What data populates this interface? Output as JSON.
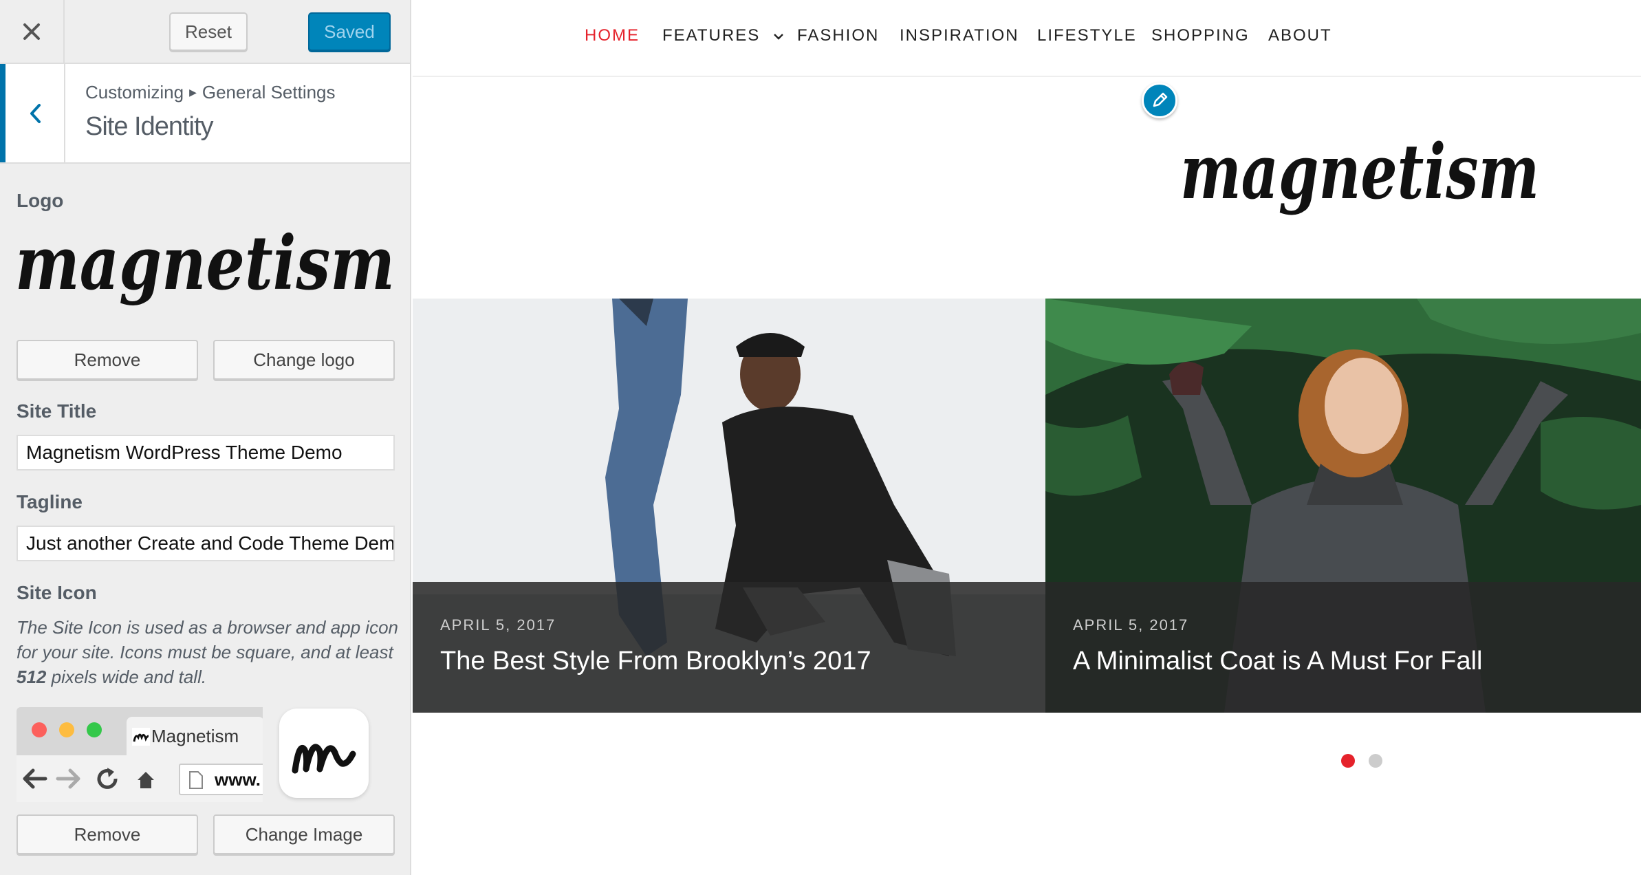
{
  "header": {
    "reset_label": "Reset",
    "saved_label": "Saved",
    "accent": "#0085ba"
  },
  "section": {
    "breadcrumb_parent": "Customizing",
    "breadcrumb_child": "General Settings",
    "title": "Site Identity"
  },
  "logo": {
    "label": "Logo",
    "wordmark": "magnetism",
    "remove_label": "Remove",
    "change_label": "Change logo"
  },
  "site_title": {
    "label": "Site Title",
    "value": "Magnetism WordPress Theme Demo"
  },
  "tagline": {
    "label": "Tagline",
    "value": "Just another Create and Code Theme Demo Sites site"
  },
  "site_icon": {
    "label": "Site Icon",
    "description_prefix": "The Site Icon is used as a browser and app icon for your site. Icons must be square, and at least ",
    "description_bold": "512",
    "description_suffix": " pixels wide and tall.",
    "tab_title": "Magnetism",
    "url": "www.",
    "remove_label": "Remove",
    "change_label": "Change Image"
  },
  "nav": {
    "items": [
      "HOME",
      "FEATURES",
      "FASHION",
      "INSPIRATION",
      "LIFESTYLE",
      "SHOPPING",
      "ABOUT"
    ],
    "active_color": "#e5222b"
  },
  "slides": [
    {
      "date": "APRIL 5, 2017",
      "title": "The Best Style From Brooklyn’s 2017"
    },
    {
      "date": "APRIL 5, 2017",
      "title": "A Minimalist Coat is A Must For Fall"
    }
  ],
  "pagination": {
    "active_color": "#e5222b",
    "inactive_color": "#cccccc"
  }
}
